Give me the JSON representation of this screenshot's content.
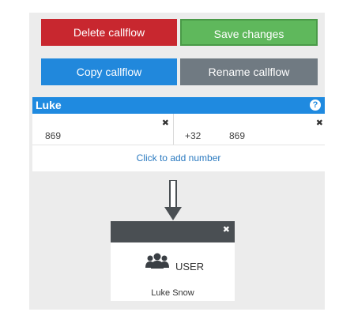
{
  "buttons": {
    "delete_label": "Delete callflow",
    "save_label": "Save changes",
    "copy_label": "Copy callflow",
    "rename_label": "Rename callflow"
  },
  "number_block": {
    "title": "Luke",
    "left_number": "869",
    "right_prefix": "+32",
    "right_number": "869",
    "add_label": "Click to add number",
    "help_icon": "?",
    "close_icon": "✖"
  },
  "user_node": {
    "type_label": "USER",
    "name": "Luke Snow",
    "close_icon": "✖"
  },
  "colors": {
    "delete": "#c8272f",
    "save": "#5fb85c",
    "copy": "#2188dc",
    "rename": "#707a82",
    "number_header": "#1f8ae0",
    "user_header": "#4a4f53"
  }
}
